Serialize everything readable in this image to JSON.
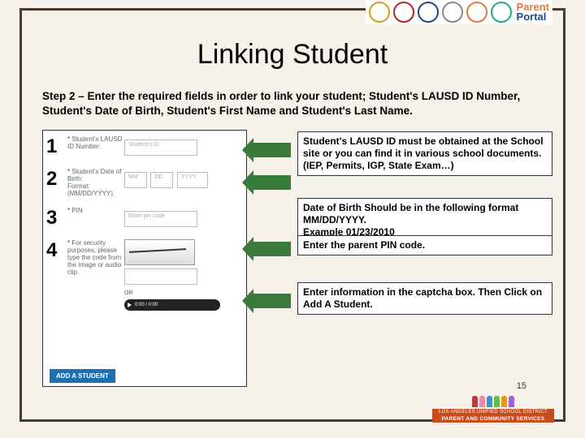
{
  "header": {
    "parent": "Parent",
    "portal": "Portal"
  },
  "title": "Linking Student",
  "intro": "Step 2 – Enter the required fields in order to link your student; Student's LAUSD ID Number, Student's Date of Birth, Student's First Name and Student's Last Name.",
  "form": {
    "r1": {
      "label": "Student's LAUSD ID Number:",
      "placeholder": "Student's ID"
    },
    "r2": {
      "label": "Student's Date of Birth:",
      "fmt": "Format: (MM/DD/YYYY)",
      "mm": "MM",
      "dd": "DD",
      "yyyy": "YYYY"
    },
    "r3": {
      "label": "PIN",
      "placeholder": "Enter pin code"
    },
    "r4": {
      "label": "For security purposes, please type the code from the image or audio clip.",
      "or": "OR",
      "time": "0:00 / 0:00"
    },
    "button": "ADD A STUDENT"
  },
  "hints": {
    "h1": "Student's LAUSD ID must be obtained at the School site or you can find it in various school documents. (IEP, Permits, IGP, State Exam…)",
    "h2a": "Date of Birth Should be in the following format MM/DD/YYYY.",
    "h2b": "Example 01/23/2010",
    "h3": "Enter the parent PIN code.",
    "h4": "Enter information in the captcha box. Then Click on Add A Student."
  },
  "slidenum": "15",
  "footer": {
    "line1": "LOS ANGELES UNIFIED SCHOOL DISTRICT",
    "line2": "PARENT AND COMMUNITY SERVICES"
  }
}
